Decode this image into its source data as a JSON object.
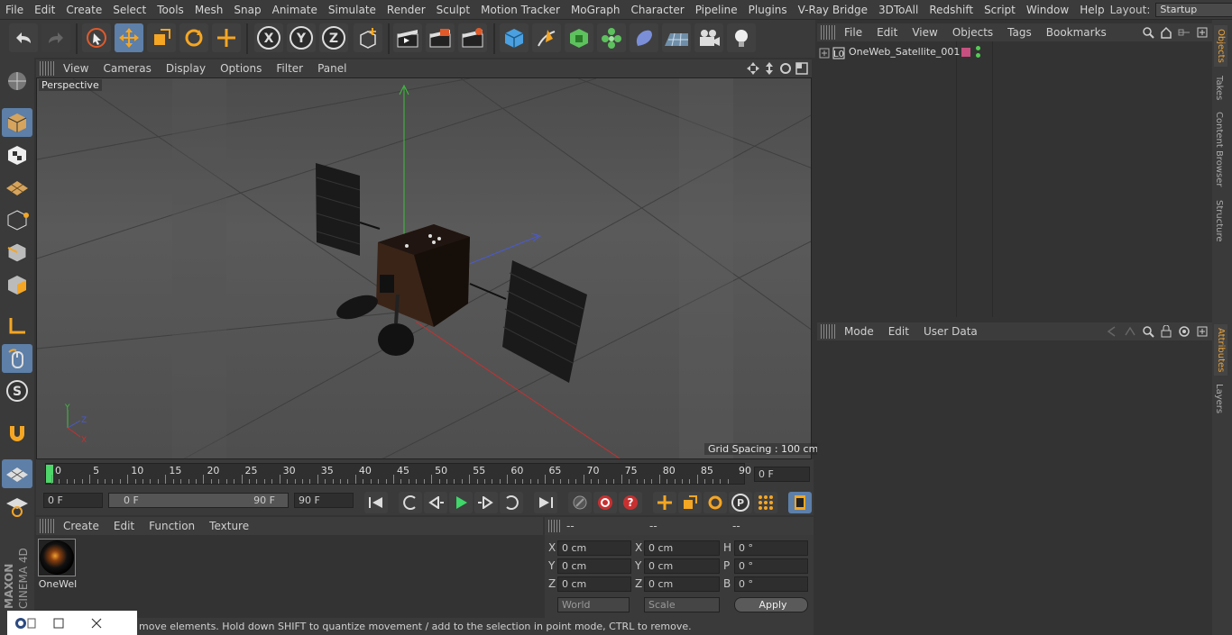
{
  "menubar": {
    "items": [
      "File",
      "Edit",
      "Create",
      "Select",
      "Tools",
      "Mesh",
      "Snap",
      "Animate",
      "Simulate",
      "Render",
      "Sculpt",
      "Motion Tracker",
      "MoGraph",
      "Character",
      "Pipeline",
      "Plugins",
      "V-Ray Bridge",
      "3DToAll",
      "Redshift",
      "Script",
      "Window",
      "Help"
    ],
    "layout_label": "Layout:",
    "layout_value": "Startup"
  },
  "viewport": {
    "menu": [
      "View",
      "Cameras",
      "Display",
      "Options",
      "Filter",
      "Panel"
    ],
    "label": "Perspective",
    "grid_spacing": "Grid Spacing : 100 cm"
  },
  "timeline": {
    "ticks": [
      "0",
      "5",
      "10",
      "15",
      "20",
      "25",
      "30",
      "35",
      "40",
      "45",
      "50",
      "55",
      "60",
      "65",
      "70",
      "75",
      "80",
      "85",
      "90"
    ],
    "frame_field": "0 F",
    "start_field": "0 F",
    "range_start": "0 F",
    "range_end": "90 F",
    "end_field": "90 F"
  },
  "material_panel": {
    "menu": [
      "Create",
      "Edit",
      "Function",
      "Texture"
    ],
    "material_name": "OneWel"
  },
  "coords": {
    "headers": [
      "--",
      "--",
      "--"
    ],
    "rows": [
      {
        "a": "X",
        "av": "0 cm",
        "b": "X",
        "bv": "0 cm",
        "c": "H",
        "cv": "0 °"
      },
      {
        "a": "Y",
        "av": "0 cm",
        "b": "Y",
        "bv": "0 cm",
        "c": "P",
        "cv": "0 °"
      },
      {
        "a": "Z",
        "av": "0 cm",
        "b": "Z",
        "bv": "0 cm",
        "c": "B",
        "cv": "0 °"
      }
    ],
    "world": "World",
    "scale": "Scale",
    "apply": "Apply"
  },
  "status": {
    "text": "move elements. Hold down SHIFT to quantize movement / add to the selection in point mode, CTRL to remove."
  },
  "objects": {
    "menu": [
      "File",
      "Edit",
      "View",
      "Objects",
      "Tags",
      "Bookmarks"
    ],
    "items": [
      {
        "name": "OneWeb_Satellite_001"
      }
    ]
  },
  "attributes": {
    "menu": [
      "Mode",
      "Edit",
      "User Data"
    ]
  },
  "righttabs": {
    "top": [
      "Objects",
      "Takes",
      "Content Browser",
      "Structure"
    ],
    "bottom": [
      "Attributes",
      "Layers"
    ]
  },
  "brand": {
    "company": "MAXON",
    "product": "CINEMA 4D"
  },
  "colors": {
    "accent": "#5d7fa8",
    "tab_active": "#e8a33c"
  }
}
